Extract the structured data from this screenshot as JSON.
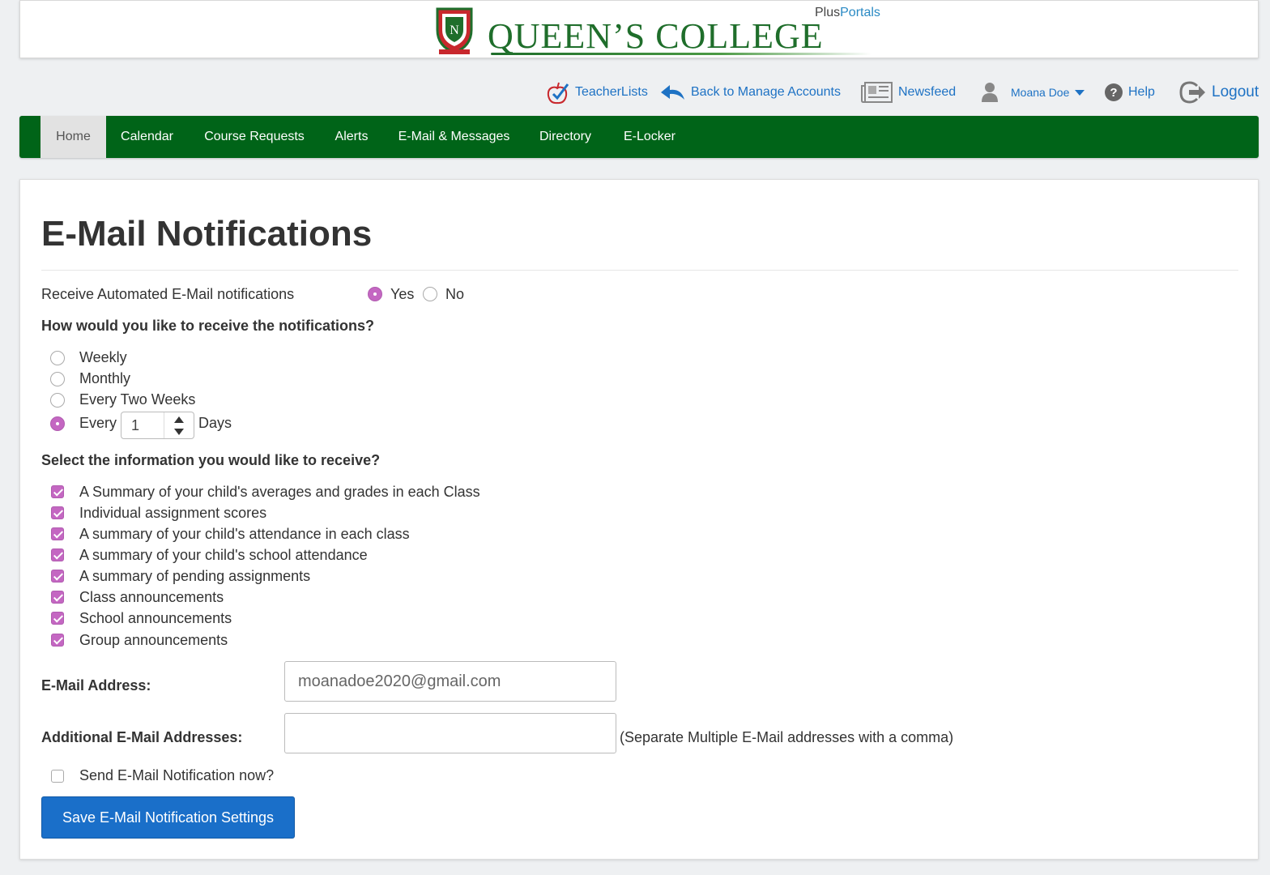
{
  "header": {
    "college_name": "QUEEN’S COLLEGE",
    "brand_plus": "Plus",
    "brand_portals": "Portals",
    "crest_icon": "school-crest-icon"
  },
  "toplinks": {
    "teacherlists": "TeacherLists",
    "back_to_manage": "Back to Manage Accounts",
    "newsfeed": "Newsfeed",
    "user_name": "Moana Doe",
    "help": "Help",
    "logout": "Logout"
  },
  "nav": {
    "items": [
      "Home",
      "Calendar",
      "Course Requests",
      "Alerts",
      "E-Mail & Messages",
      "Directory",
      "E-Locker"
    ],
    "active": "Home"
  },
  "page": {
    "title": "E-Mail Notifications",
    "receive_label": "Receive Automated E-Mail notifications",
    "yes_label": "Yes",
    "no_label": "No",
    "receive_value": "Yes",
    "frequency_question": "How would you like to receive the notifications?",
    "frequency_options": [
      "Weekly",
      "Monthly",
      "Every Two Weeks"
    ],
    "every_label": "Every",
    "every_value": "1",
    "days_label": "Days",
    "frequency_selected": "Every N Days",
    "info_question": "Select the information you would like to receive?",
    "info_options": [
      "A Summary of your child's averages and grades in each Class",
      "Individual assignment scores",
      "A summary of your child's attendance in each class",
      "A summary of your child's school attendance",
      "A summary of pending assignments",
      "Class announcements",
      "School announcements",
      "Group announcements"
    ],
    "info_checked": [
      true,
      true,
      true,
      true,
      true,
      true,
      true,
      true
    ],
    "email_label": "E-Mail Address:",
    "email_value": "moanadoe2020@gmail.com",
    "additional_label": "Additional E-Mail Addresses:",
    "additional_value": "",
    "additional_hint": "(Separate Multiple E-Mail addresses with a comma)",
    "send_now_label": "Send E-Mail Notification now?",
    "send_now_checked": false,
    "save_label": "Save E-Mail Notification Settings"
  },
  "colors": {
    "nav_green": "#006418",
    "brand_green": "#1f6e2b",
    "link_blue": "#1e72c4",
    "accent_purple": "#c467c2",
    "button_blue": "#1a6fc9"
  }
}
